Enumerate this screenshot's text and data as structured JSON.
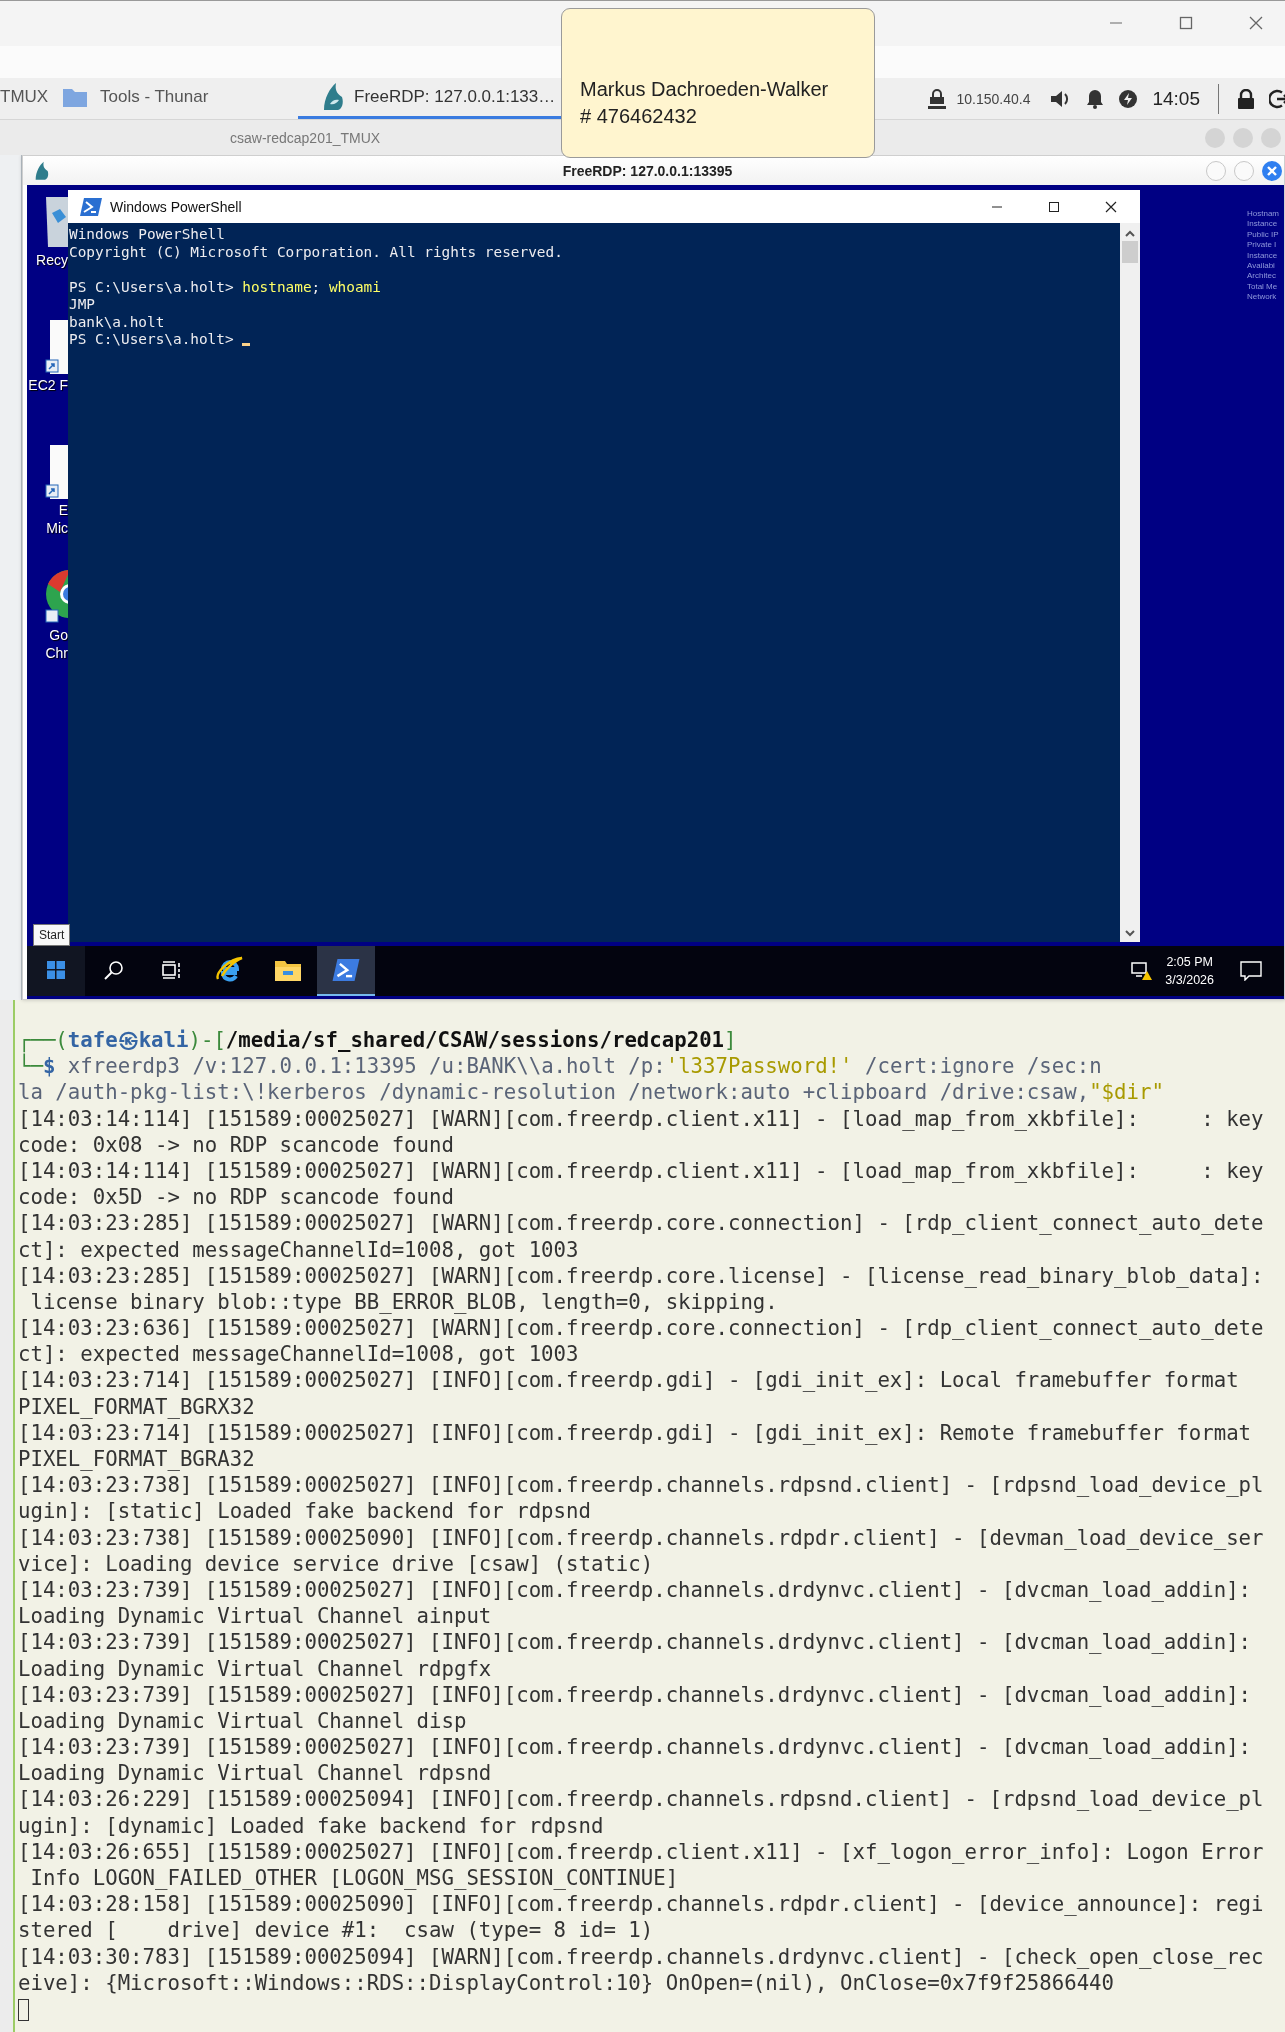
{
  "panel": {
    "tasks": [
      {
        "kind": "plain",
        "label": "TMUX",
        "selected": false
      },
      {
        "kind": "folder",
        "label": "Tools - Thunar",
        "selected": false
      },
      {
        "kind": "freerdp",
        "label": "FreeRDP: 127.0.0.1:133…",
        "selected": true
      }
    ],
    "tray": {
      "ip": "10.150.40.4",
      "clock": "14:05"
    }
  },
  "tooltip": {
    "lines": [
      "Markus Dachroeden-Walker",
      "# 476462432"
    ]
  },
  "background_window": {
    "title": "csaw-redcap201_TMUX"
  },
  "rdp_window": {
    "title": "FreeRDP: 127.0.0.1:13395",
    "desktop": {
      "icons": [
        {
          "kind": "recycle",
          "label_lines": [
            "Recy"
          ]
        },
        {
          "kind": "document",
          "label_lines": [
            "EC2 F"
          ]
        },
        {
          "kind": "document",
          "label_lines": [
            "E",
            "Mic"
          ]
        },
        {
          "kind": "chrome",
          "label_lines": [
            "Go",
            "Chr"
          ]
        }
      ],
      "info_lines": [
        "Hostnam",
        "Instance",
        "Public IP",
        "Private I",
        "Instance",
        "Availabi",
        "Architec",
        "Total Me",
        "Network"
      ],
      "start_tooltip": "Start",
      "powershell": {
        "title": "Windows PowerShell",
        "lines": [
          {
            "blank_before": false,
            "cursor": false,
            "segments": [
              {
                "kind": "out",
                "text": "Windows PowerShell"
              }
            ]
          },
          {
            "blank_before": false,
            "cursor": false,
            "segments": [
              {
                "kind": "out",
                "text": "Copyright (C) Microsoft Corporation. All rights reserved."
              }
            ]
          },
          {
            "blank_before": true,
            "cursor": false,
            "segments": [
              {
                "kind": "out",
                "text": "PS C:\\Users\\a.holt> "
              },
              {
                "kind": "command",
                "text": "hostname"
              },
              {
                "kind": "out",
                "text": "; "
              },
              {
                "kind": "command",
                "text": "whoami"
              }
            ]
          },
          {
            "blank_before": false,
            "cursor": false,
            "segments": [
              {
                "kind": "out",
                "text": "JMP"
              }
            ]
          },
          {
            "blank_before": false,
            "cursor": false,
            "segments": [
              {
                "kind": "out",
                "text": "bank\\a.holt"
              }
            ]
          },
          {
            "blank_before": false,
            "cursor": true,
            "segments": [
              {
                "kind": "out",
                "text": "PS C:\\Users\\a.holt> "
              }
            ]
          }
        ]
      },
      "taskbar": {
        "apps": [
          {
            "kind": "start",
            "selected": false
          },
          {
            "kind": "search",
            "selected": false
          },
          {
            "kind": "taskview",
            "selected": false
          },
          {
            "kind": "ie",
            "selected": false
          },
          {
            "kind": "explorer",
            "selected": false
          },
          {
            "kind": "powershell",
            "selected": true
          }
        ],
        "time": "2:05 PM",
        "date": "3/3/2026"
      }
    }
  },
  "terminal": {
    "prompt": {
      "open": "┌──(",
      "close_open": ")-[",
      "close": "]",
      "corner": "└─",
      "symbol": "$",
      "user": "tafe",
      "at": "㉿",
      "host": "kali",
      "path": "/media/sf_shared/CSAW/sessions/redcap201"
    },
    "command_rows": [
      [
        {
          "kind": "program",
          "text": "xfreerdp3"
        },
        {
          "kind": "arg",
          "text": " /v:127.0.0.1:13395 /u:BANK\\\\a.holt /p:"
        },
        {
          "kind": "string",
          "text": "'l337Password!'"
        },
        {
          "kind": "arg",
          "text": " /cert:ignore /sec:n"
        }
      ],
      [
        {
          "kind": "arg",
          "text": "la /auth-pkg-list:\\!kerberos /dynamic-resolution /network:auto +clipboard /drive:csaw,"
        },
        {
          "kind": "string",
          "text": "\"$dir\""
        }
      ]
    ],
    "log": [
      {
        "rows": [
          "[14:03:14:114] [151589:00025027] [WARN][com.freerdp.client.x11] - [load_map_from_xkbfile]:     : key",
          "code: 0x08 -> no RDP scancode found"
        ]
      },
      {
        "rows": [
          "[14:03:14:114] [151589:00025027] [WARN][com.freerdp.client.x11] - [load_map_from_xkbfile]:     : key",
          "code: 0x5D -> no RDP scancode found"
        ]
      },
      {
        "rows": [
          "[14:03:23:285] [151589:00025027] [WARN][com.freerdp.core.connection] - [rdp_client_connect_auto_dete",
          "ct]: expected messageChannelId=1008, got 1003"
        ]
      },
      {
        "rows": [
          "[14:03:23:285] [151589:00025027] [WARN][com.freerdp.core.license] - [license_read_binary_blob_data]:",
          " license binary blob::type BB_ERROR_BLOB, length=0, skipping."
        ]
      },
      {
        "rows": [
          "[14:03:23:636] [151589:00025027] [WARN][com.freerdp.core.connection] - [rdp_client_connect_auto_dete",
          "ct]: expected messageChannelId=1008, got 1003"
        ]
      },
      {
        "rows": [
          "[14:03:23:714] [151589:00025027] [INFO][com.freerdp.gdi] - [gdi_init_ex]: Local framebuffer format",
          "PIXEL_FORMAT_BGRX32"
        ]
      },
      {
        "rows": [
          "[14:03:23:714] [151589:00025027] [INFO][com.freerdp.gdi] - [gdi_init_ex]: Remote framebuffer format",
          "PIXEL_FORMAT_BGRA32"
        ]
      },
      {
        "rows": [
          "[14:03:23:738] [151589:00025027] [INFO][com.freerdp.channels.rdpsnd.client] - [rdpsnd_load_device_pl",
          "ugin]: [static] Loaded fake backend for rdpsnd"
        ]
      },
      {
        "rows": [
          "[14:03:23:738] [151589:00025090] [INFO][com.freerdp.channels.rdpdr.client] - [devman_load_device_ser",
          "vice]: Loading device service drive [csaw] (static)"
        ]
      },
      {
        "rows": [
          "[14:03:23:739] [151589:00025027] [INFO][com.freerdp.channels.drdynvc.client] - [dvcman_load_addin]:",
          "Loading Dynamic Virtual Channel ainput"
        ]
      },
      {
        "rows": [
          "[14:03:23:739] [151589:00025027] [INFO][com.freerdp.channels.drdynvc.client] - [dvcman_load_addin]:",
          "Loading Dynamic Virtual Channel rdpgfx"
        ]
      },
      {
        "rows": [
          "[14:03:23:739] [151589:00025027] [INFO][com.freerdp.channels.drdynvc.client] - [dvcman_load_addin]:",
          "Loading Dynamic Virtual Channel disp"
        ]
      },
      {
        "rows": [
          "[14:03:23:739] [151589:00025027] [INFO][com.freerdp.channels.drdynvc.client] - [dvcman_load_addin]:",
          "Loading Dynamic Virtual Channel rdpsnd"
        ]
      },
      {
        "rows": [
          "[14:03:26:229] [151589:00025094] [INFO][com.freerdp.channels.rdpsnd.client] - [rdpsnd_load_device_pl",
          "ugin]: [dynamic] Loaded fake backend for rdpsnd"
        ]
      },
      {
        "rows": [
          "[14:03:26:655] [151589:00025027] [INFO][com.freerdp.client.x11] - [xf_logon_error_info]: Logon Error",
          " Info LOGON_FAILED_OTHER [LOGON_MSG_SESSION_CONTINUE]"
        ]
      },
      {
        "rows": [
          "[14:03:28:158] [151589:00025090] [INFO][com.freerdp.channels.rdpdr.client] - [device_announce]: regi",
          "stered [    drive] device #1:  csaw (type= 8 id= 1)"
        ]
      },
      {
        "rows": [
          "[14:03:30:783] [151589:00025094] [WARN][com.freerdp.channels.drdynvc.client] - [check_open_close_rec",
          "eive]: {Microsoft::Windows::RDS::DisplayControl:10} OnOpen=(nil), OnClose=0x7f9f25866440"
        ]
      }
    ],
    "cursor": true
  }
}
